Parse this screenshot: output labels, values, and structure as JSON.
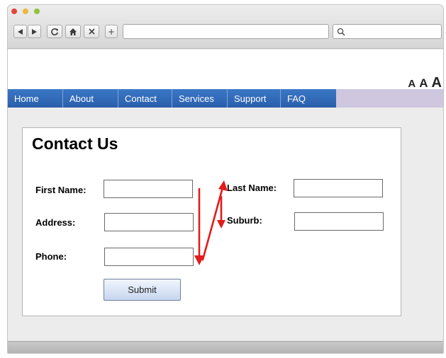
{
  "toolbar": {
    "buttons": [
      "back",
      "forward",
      "reload",
      "home",
      "stop",
      "new-tab"
    ],
    "new_tab_glyph": "+",
    "url_value": "",
    "search_value": ""
  },
  "page": {
    "font_size_controls": [
      "A",
      "A",
      "A"
    ],
    "menu": [
      "Home",
      "About",
      "Contact",
      "Services",
      "Support",
      "FAQ"
    ],
    "accent_color": "#2f68b6"
  },
  "form": {
    "title": "Contact Us",
    "first_name_label": "First Name:",
    "last_name_label": "Last Name:",
    "address_label": "Address:",
    "suburb_label": "Suburb:",
    "phone_label": "Phone:",
    "first_name_value": "",
    "last_name_value": "",
    "address_value": "",
    "suburb_value": "",
    "phone_value": "",
    "submit_label": "Submit"
  },
  "annotation": {
    "arrow_color": "#e31b1b"
  }
}
